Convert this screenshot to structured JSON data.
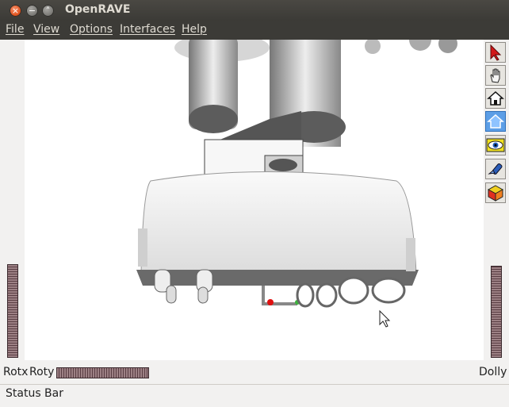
{
  "window": {
    "title": "OpenRAVE",
    "close_glyph": "×",
    "min_glyph": "−",
    "max_glyph": "˄"
  },
  "menubar": [
    "File",
    "View",
    "Options",
    "Interfaces",
    "Help"
  ],
  "toolbar": [
    {
      "icon": "arrow-pointer-icon",
      "active": false
    },
    {
      "icon": "hand-icon",
      "active": false
    },
    {
      "icon": "home-icon",
      "active": false
    },
    {
      "icon": "set-home-icon",
      "active": true
    },
    {
      "icon": "eye-icon",
      "active": false
    },
    {
      "icon": "flashlight-icon",
      "active": false
    },
    {
      "icon": "cube-icon",
      "active": false
    }
  ],
  "wheels": {
    "rotx": "Rotx",
    "roty": "Roty",
    "dolly": "Dolly"
  },
  "status": "Status Bar"
}
